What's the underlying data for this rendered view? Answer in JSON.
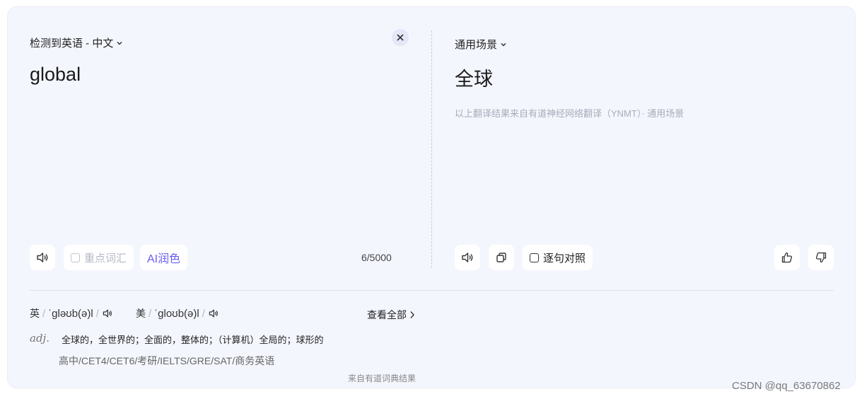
{
  "source": {
    "lang_detect": "检测到英语 - 中文",
    "text": "global",
    "char_count": "6/5000",
    "key_words_label": "重点词汇",
    "ai_polish_label": "AI润色"
  },
  "target": {
    "scene": "通用场景",
    "text": "全球",
    "attribution": "以上翻译结果来自有道神经网络翻译（YNMT）· 通用场景",
    "sentence_align_label": "逐句对照"
  },
  "dictionary": {
    "uk_label": "英",
    "uk_phonetic": "ˈɡləʊb(ə)l",
    "us_label": "美",
    "us_phonetic": "ˈɡloʊb(ə)l",
    "view_all": "查看全部",
    "pos": "adj.",
    "meaning": "全球的，全世界的；全面的，整体的；（计算机）全局的；球形的",
    "exams": "高中/CET4/CET6/考研/IELTS/GRE/SAT/商务英语",
    "source_note": "来自有道词典结果"
  },
  "watermark": "CSDN @qq_63670862",
  "colors": {
    "background": "#f4f6fe",
    "ai_accent": "#6a5ef0",
    "muted": "#a8acb8"
  }
}
